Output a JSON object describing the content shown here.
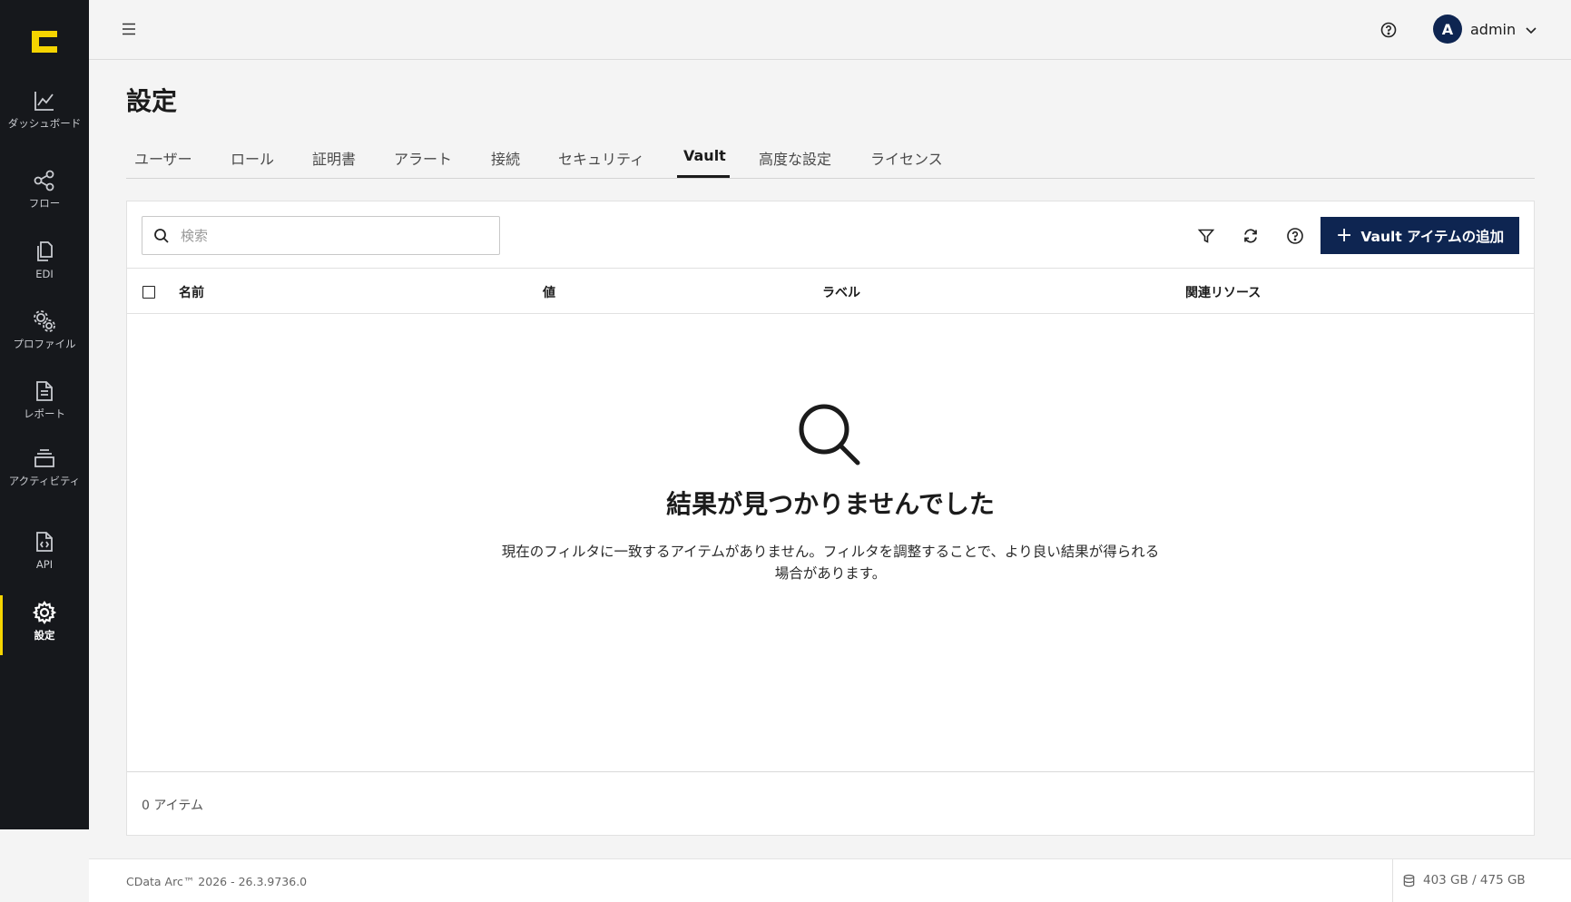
{
  "sidebar": {
    "items": [
      {
        "label": "ダッシュボード",
        "icon": "chart-line-icon"
      },
      {
        "label": "フロー",
        "icon": "share-nodes-icon"
      },
      {
        "label": "EDI",
        "icon": "documents-icon"
      },
      {
        "label": "プロファイル",
        "icon": "gears-icon"
      },
      {
        "label": "レポート",
        "icon": "report-document-icon"
      },
      {
        "label": "アクティビティ",
        "icon": "layers-icon"
      },
      {
        "label": "API",
        "icon": "code-file-icon"
      },
      {
        "label": "設定",
        "icon": "settings-gear-icon",
        "active": true
      }
    ]
  },
  "header": {
    "user_initial": "A",
    "username": "admin"
  },
  "page": {
    "title": "設定"
  },
  "tabs": [
    {
      "label": "ユーザー"
    },
    {
      "label": "ロール"
    },
    {
      "label": "証明書"
    },
    {
      "label": "アラート"
    },
    {
      "label": "接続"
    },
    {
      "label": "セキュリティ"
    },
    {
      "label": "Vault",
      "active": true
    },
    {
      "label": "高度な設定"
    },
    {
      "label": "ライセンス"
    }
  ],
  "toolbar": {
    "search_placeholder": "検索",
    "add_button": "Vault アイテムの追加"
  },
  "table": {
    "columns": [
      "名前",
      "値",
      "ラベル",
      "関連リソース"
    ]
  },
  "empty_state": {
    "title": "結果が見つかりませんでした",
    "description_line1": "現在のフィルタに一致するアイテムがありません。フィルタを調整することで、より良い結果が得られる",
    "description_line2": "場合があります。"
  },
  "card_footer": {
    "count": "0 アイテム"
  },
  "footer": {
    "version": "CData Arc™ 2026 - 26.3.9736.0",
    "storage": "403 GB / 475 GB"
  },
  "colors": {
    "sidebar_bg": "#16181c",
    "brand_yellow": "#f5d400",
    "primary_navy": "#0e2551"
  }
}
